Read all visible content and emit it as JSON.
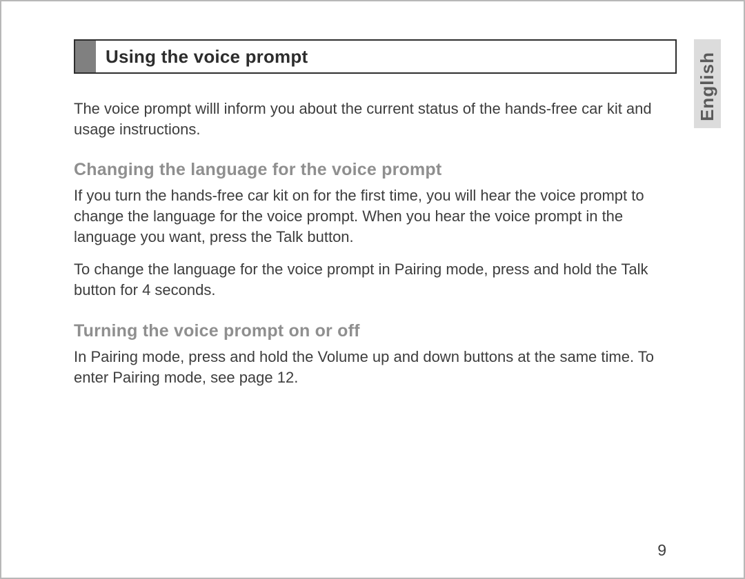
{
  "section": {
    "title": "Using the voice prompt",
    "intro": "The voice prompt willl inform you about the current status of the hands-free car kit and usage instructions."
  },
  "sub1": {
    "heading": "Changing the language for the voice prompt",
    "p1": "If you turn the hands-free car kit on for the first time, you will hear the voice prompt to change the language for the voice prompt. When you hear the voice prompt in the language you want, press the Talk button.",
    "p2": "To change the language for the voice prompt in Pairing mode, press and hold the Talk button for 4 seconds."
  },
  "sub2": {
    "heading": "Turning the voice prompt on or off",
    "p1": "In Pairing mode, press and hold the Volume up and down buttons at the same time. To enter Pairing mode, see page 12."
  },
  "language_tab": "English",
  "page_number": "9"
}
